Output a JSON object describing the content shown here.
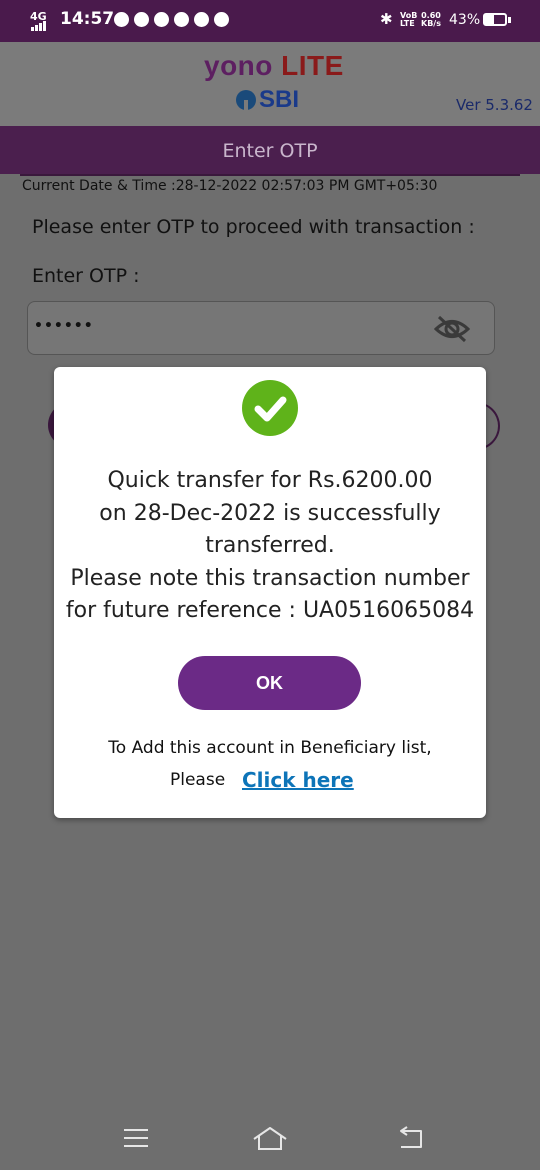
{
  "status_bar": {
    "network": "4G",
    "time": "14:57",
    "lte_label_1": "VoB",
    "lte_label_2": "LTE",
    "speed_value": "0.60",
    "speed_unit": "KB/s",
    "battery": "43%",
    "battery_level": 0.43
  },
  "header": {
    "logo_yono": "yono",
    "logo_lite": "LITE",
    "logo_sbi": "SBI",
    "version": "Ver 5.3.62"
  },
  "page": {
    "title": "Enter OTP",
    "datetime": "Current Date & Time :28-12-2022 02:57:03 PM GMT+05:30",
    "prompt": "Please enter OTP to proceed with transaction :",
    "otp_label": "Enter OTP :",
    "otp_value": "••••••"
  },
  "dialog": {
    "message_lines": [
      "Quick transfer for Rs.6200.00",
      "on 28-Dec-2022 is successfully",
      "transferred.",
      "Please note this transaction number",
      "for future reference : UA0516065084"
    ],
    "ok_label": "OK",
    "beneficiary_text": "To Add this account in Beneficiary list,",
    "please_text": "Please",
    "click_here": "Click here"
  },
  "colors": {
    "status_bar": "#4a1a4c",
    "title_bar": "#4b1f4e",
    "ok_button": "#6b2a86",
    "success": "#5fb31a",
    "link": "#0d74b8"
  },
  "icons": [
    "eye-off-icon",
    "check-circle-icon",
    "menu-icon",
    "home-icon",
    "back-icon",
    "bluetooth-icon"
  ]
}
